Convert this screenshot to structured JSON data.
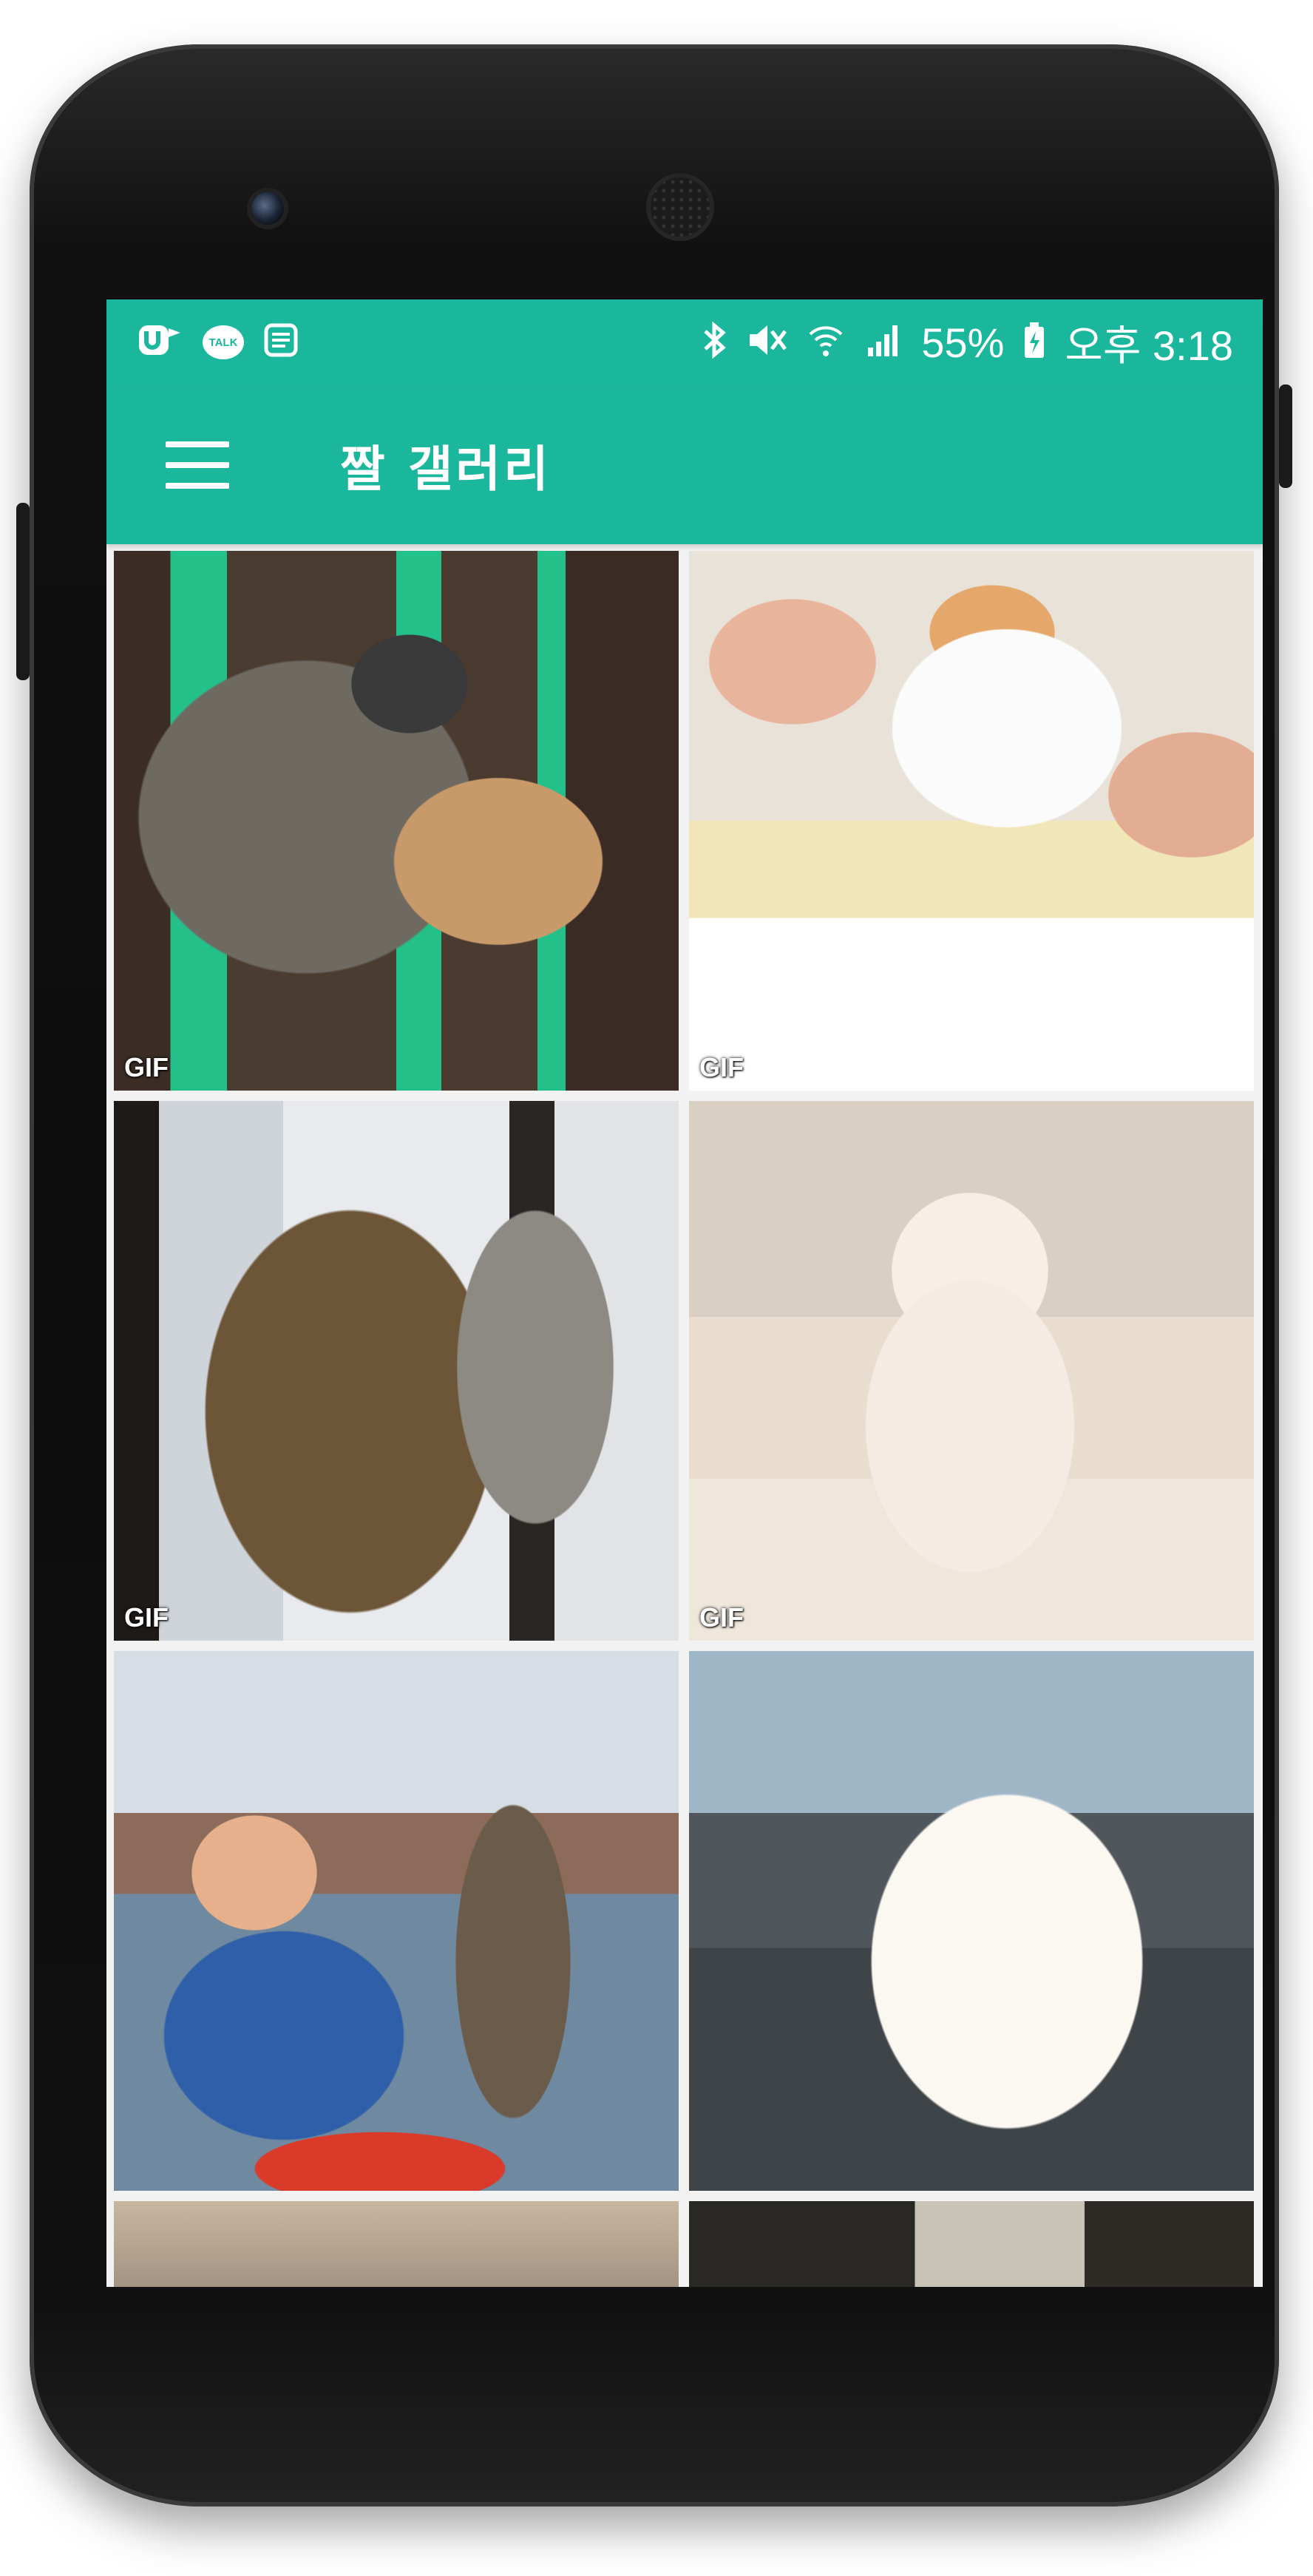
{
  "status_bar": {
    "left_icons": [
      "ustore-icon",
      "kakaotalk-icon",
      "message-icon"
    ],
    "talk_label": "TALK",
    "right_icons": [
      "bluetooth-icon",
      "mute-icon",
      "wifi-icon",
      "signal-icon"
    ],
    "battery": "55%",
    "time": "오후 3:18"
  },
  "app_bar": {
    "title": "짤 갤러리"
  },
  "gallery": {
    "items": [
      {
        "badge": "GIF"
      },
      {
        "badge": "GIF"
      },
      {
        "badge": "GIF"
      },
      {
        "badge": "GIF"
      },
      {
        "badge": ""
      },
      {
        "badge": ""
      }
    ]
  },
  "colors": {
    "accent": "#1ab79c",
    "phone_body": "#111111"
  }
}
